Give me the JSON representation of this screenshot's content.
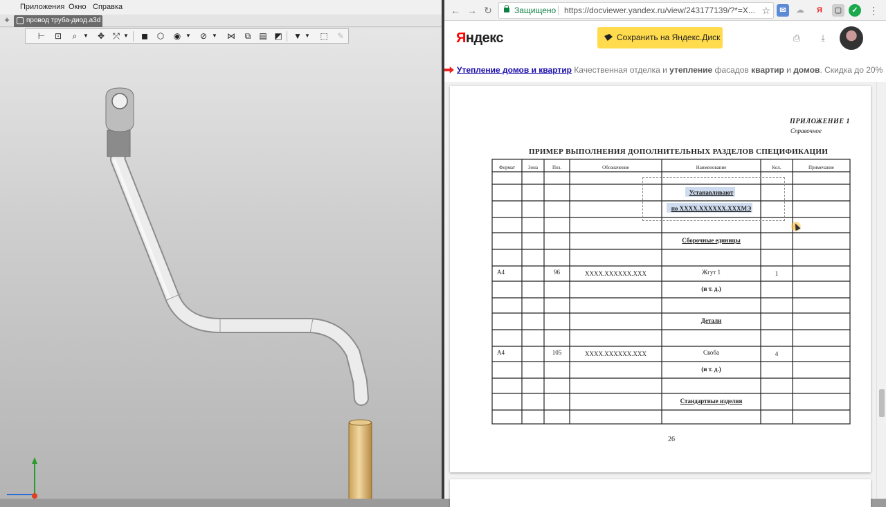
{
  "cad": {
    "menu": [
      "Приложения",
      "Окно",
      "Справка"
    ],
    "tab_title": "провод труба-диод.a3d",
    "toolbar_icons": [
      "tree-icon",
      "hierarchy-icon",
      "zoom-icon",
      "pan-icon",
      "orient-icon",
      "shaded-icon",
      "wireframe-icon",
      "hide-icon",
      "section-icon",
      "measure-icon",
      "view-icon",
      "filter-icon",
      "select-icon",
      "edit-icon"
    ]
  },
  "browser": {
    "secure_label": "Защищено",
    "url": "https://docviewer.yandex.ru/view/243177139/?*=X...",
    "logo": "Яндекс",
    "save_button": "Сохранить на Яндекс.Диск",
    "ad": {
      "link": "Утепление домов и квартир",
      "text_parts": [
        "Качественная отделка и ",
        "утепление",
        " фасадов ",
        "квартир",
        " и ",
        "домов",
        ". Скидка до 20%"
      ]
    },
    "accent_color": "#ffdb4d"
  },
  "document": {
    "appendix": "ПРИЛОЖЕНИЕ 1",
    "appendix_note": "Справочное",
    "title": "ПРИМЕР  ВЫПОЛНЕНИЯ ДОПОЛНИТЕЛЬНЫХ РАЗДЕЛОВ СПЕЦИФИКАЦИИ",
    "columns": [
      "Формат",
      "Зона",
      "Поз.",
      "Обозначение",
      "Наименование",
      "Кол.",
      "Примечание"
    ],
    "rows": {
      "install_1": "Устанавливают",
      "install_2": "по ХХХХ.ХХХХХХ.ХХХМЭ",
      "section_assembly": "Сборочные  единицы",
      "row1_format": "А4",
      "row1_pos": "96",
      "row1_code": "ХХХХ.ХХХХХХ.ХХХ",
      "row1_name": "Жгут 1",
      "row1_qty": "1",
      "etc1": "(и т. д.)",
      "section_details": "Детали",
      "row2_format": "А4",
      "row2_pos": "105",
      "row2_code": "ХХХХ.ХХХХХХ.ХХХ",
      "row2_name": "Скоба",
      "row2_qty": "4",
      "etc2": "(и т. д.)",
      "section_standard": "Стандартные изделия"
    },
    "page_number": "26"
  }
}
